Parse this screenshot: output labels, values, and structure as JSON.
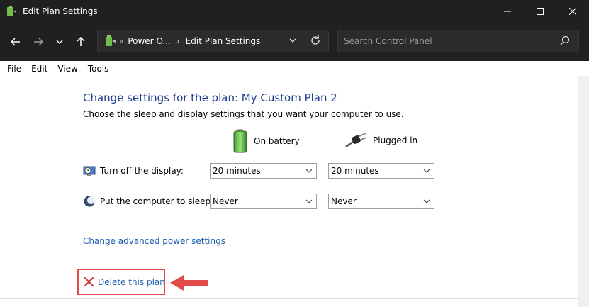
{
  "window": {
    "title": "Edit Plan Settings"
  },
  "address": {
    "crumbs": [
      "Power O...",
      "Edit Plan Settings"
    ]
  },
  "search": {
    "placeholder": "Search Control Panel"
  },
  "menu": [
    "File",
    "Edit",
    "View",
    "Tools"
  ],
  "main": {
    "heading": "Change settings for the plan: My Custom Plan 2",
    "subtext": "Choose the sleep and display settings that you want your computer to use.",
    "columns": {
      "battery": "On battery",
      "plugged": "Plugged in"
    },
    "rows": [
      {
        "label": "Turn off the display:",
        "battery": "20 minutes",
        "plugged": "20 minutes"
      },
      {
        "label": "Put the computer to sleep:",
        "battery": "Never",
        "plugged": "Never"
      }
    ],
    "advanced_link": "Change advanced power settings",
    "delete_link": "Delete this plan"
  },
  "colors": {
    "chrome": "#202020",
    "heading": "#1f3c8c",
    "link": "#1a5fb4",
    "highlight": "#e14b4b"
  }
}
